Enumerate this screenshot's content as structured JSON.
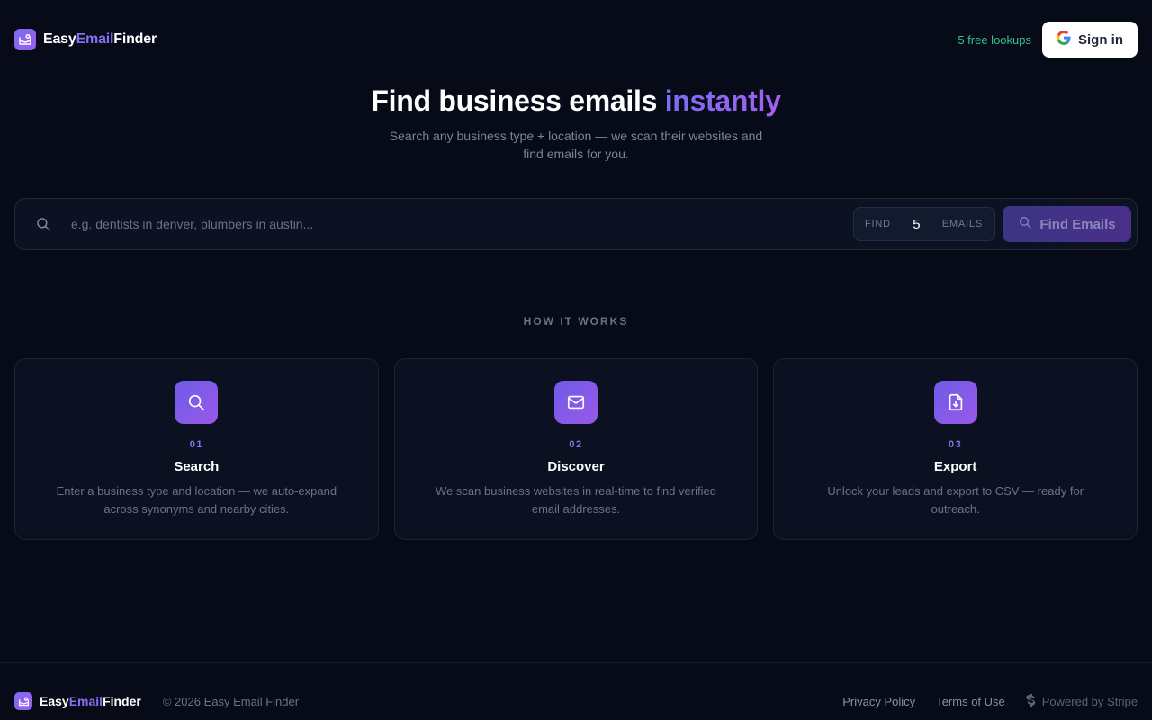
{
  "header": {
    "brand": {
      "part1": "Easy",
      "part2": "Email",
      "part3": "Finder"
    },
    "free_lookups": "5 free lookups",
    "signin_label": "Sign in"
  },
  "hero": {
    "title_main": "Find business emails",
    "title_accent": "instantly",
    "subtitle": "Search any business type + location — we scan their websites and find emails for you."
  },
  "search": {
    "placeholder": "e.g. dentists in denver, plumbers in austin...",
    "value": "",
    "find_label": "FIND",
    "count_value": "5",
    "emails_label": "EMAILS",
    "button_label": "Find Emails"
  },
  "how_it_works": {
    "title": "HOW IT WORKS",
    "steps": [
      {
        "num": "01",
        "title": "Search",
        "desc": "Enter a business type and location — we auto-expand across synonyms and nearby cities.",
        "icon": "search-icon"
      },
      {
        "num": "02",
        "title": "Discover",
        "desc": "We scan business websites in real-time to find verified email addresses.",
        "icon": "mail-icon"
      },
      {
        "num": "03",
        "title": "Export",
        "desc": "Unlock your leads and export to CSV — ready for outreach.",
        "icon": "file-download-icon"
      }
    ]
  },
  "footer": {
    "brand": {
      "part1": "Easy",
      "part2": "Email",
      "part3": "Finder"
    },
    "copyright": "© 2026 Easy Email Finder",
    "links": {
      "privacy": "Privacy Policy",
      "terms": "Terms of Use"
    },
    "powered": "Powered by Stripe"
  },
  "colors": {
    "background": "#060b17",
    "accent": "#8b6cf5",
    "success": "#34c38f"
  }
}
